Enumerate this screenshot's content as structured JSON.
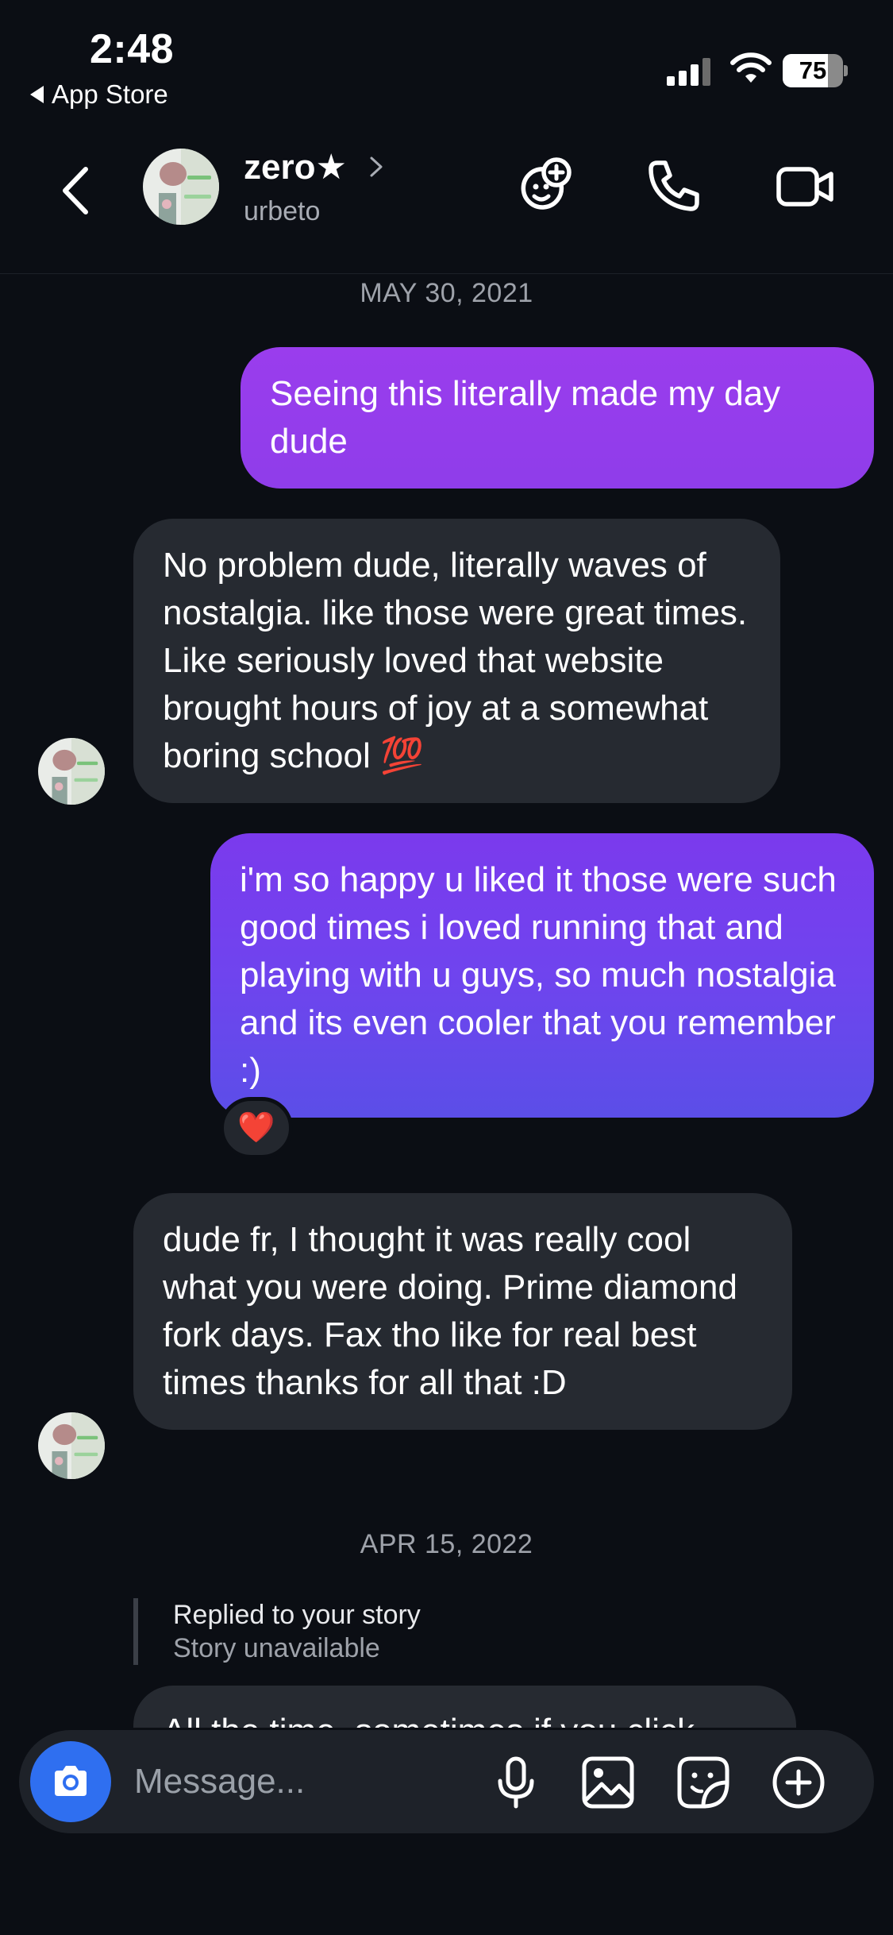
{
  "status_bar": {
    "time": "2:48",
    "back_label": "App Store",
    "battery": "75",
    "battery_level": 0.75
  },
  "header": {
    "name": "zero★",
    "username": "urbeto",
    "icons": [
      "back-chevron-icon",
      "effects-icon",
      "phone-icon",
      "video-camera-icon"
    ]
  },
  "messages": [
    {
      "type": "date",
      "text": "MAY 30, 2021"
    },
    {
      "type": "sent",
      "text": "Seeing this literally made my day dude"
    },
    {
      "type": "received",
      "text": "No problem dude, literally waves of nostalgia. like those were great times. Like seriously loved that website brought hours of joy at a somewhat boring school 💯"
    },
    {
      "type": "sent",
      "text": "i'm so happy u liked it those were such good times i loved running that and playing with u guys, so much nostalgia and its even cooler that you remember :)",
      "reaction": "❤️"
    },
    {
      "type": "received",
      "text": "dude fr, I thought it was really cool what you were doing. Prime diamond fork days. Fax tho like for real best times thanks for all that :D"
    },
    {
      "type": "date",
      "text": "APR 15, 2022"
    },
    {
      "type": "story_reply",
      "title": "Replied to your story",
      "subtitle": "Story unavailable"
    },
    {
      "type": "received_partial",
      "text": "All the time, sometimes if you click"
    }
  ],
  "composer": {
    "placeholder": "Message...",
    "icons": [
      "camera-icon",
      "microphone-icon",
      "gallery-icon",
      "sticker-icon",
      "plus-icon"
    ]
  },
  "colors": {
    "background": "#0b0e14",
    "sent_bubble_top": "#9a3ded",
    "sent_bubble_bottom": "#5b4ee8",
    "received_bubble": "#262a31",
    "camera_button": "#2f6ff0"
  }
}
